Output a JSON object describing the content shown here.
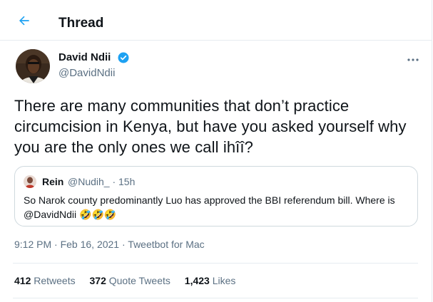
{
  "header": {
    "title": "Thread",
    "back_icon": "arrow-left-icon",
    "accent": "#1da1f2"
  },
  "tweet": {
    "author_name": "David Ndii",
    "author_handle": "@DavidNdii",
    "verified_icon": "verified-badge-icon",
    "more_icon": "more-horizontal-icon",
    "text": "There are many communities that don’t practice circumcision in Kenya, but have  you asked yourself why you are the only ones we call ihîî?",
    "timestamp": "9:12 PM · Feb 16, 2021",
    "separator": " · ",
    "client": "Tweetbot for Mac"
  },
  "quote": {
    "name": "Rein",
    "handle_time": "@Nudih_ · 15h",
    "text": "So Narok county predominantly Luo has approved the BBI referendum bill. Where is @DavidNdii",
    "emojis": "🤣🤣🤣"
  },
  "stats": {
    "retweets_count": "412",
    "retweets_label": "Retweets",
    "quote_count": "372",
    "quote_label": "Quote Tweets",
    "likes_count": "1,423",
    "likes_label": "Likes"
  }
}
